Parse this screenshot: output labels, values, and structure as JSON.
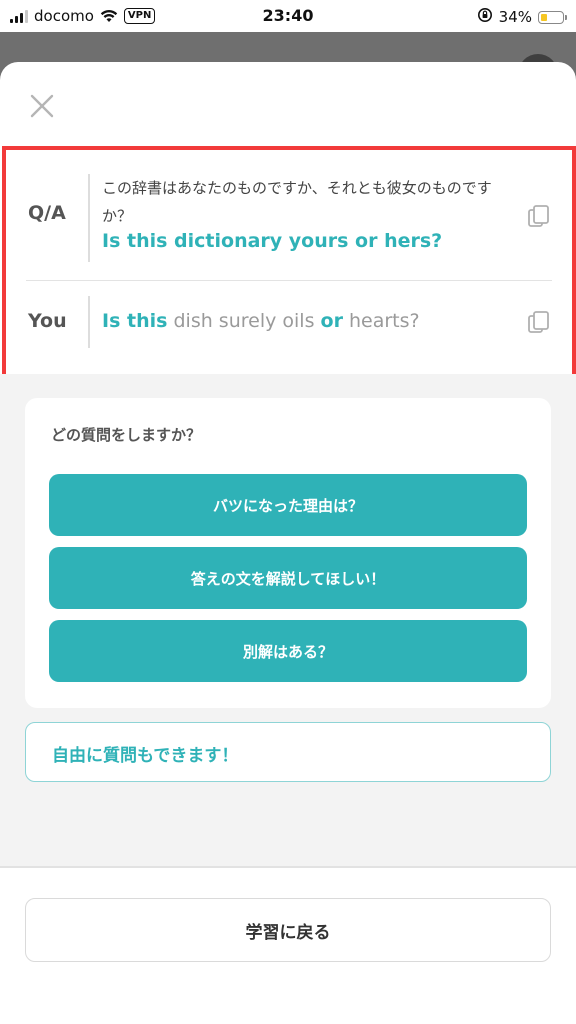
{
  "status_bar": {
    "carrier": "docomo",
    "vpn": "VPN",
    "time": "23:40",
    "battery": "34%",
    "battery_level": 0.34,
    "battery_color": "#f6c623"
  },
  "sheet": {
    "close_icon": "close-icon",
    "qa": {
      "label": "Q/A",
      "question_jp": "この辞書はあなたのものですか、それとも彼女のものですか？",
      "answer_en": "Is this dictionary yours or hers?",
      "copy_icon": "copy-icon"
    },
    "you": {
      "label": "You",
      "segments": [
        "Is this",
        " dish surely oils ",
        "or",
        " hearts?"
      ],
      "copy_icon": "copy-icon"
    },
    "question_card": {
      "title": "どの質問をしますか？",
      "buttons": [
        {
          "label": "バツになった理由は？"
        },
        {
          "label": "答えの文を解説してほしい！"
        },
        {
          "label": "別解はある？"
        }
      ]
    },
    "free_question": "自由に質問もできます！",
    "back_button": "学習に戻る"
  },
  "colors": {
    "accent": "#2fb2b7",
    "highlight_border": "#f23a3a",
    "background_gray": "#f3f3f3"
  }
}
